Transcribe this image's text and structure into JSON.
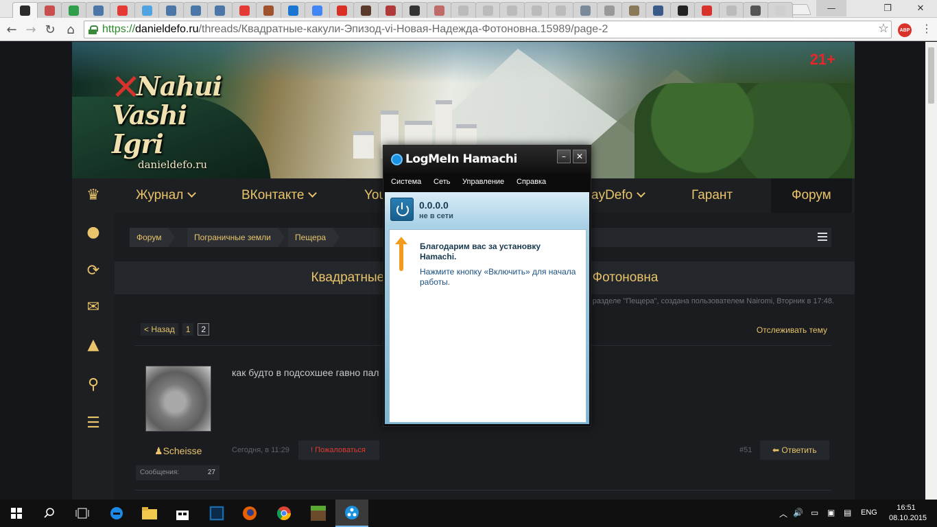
{
  "browser": {
    "url_scheme": "https://",
    "url_host": "danieldefo.ru",
    "url_path": "/threads/Квадратные-какули-Эпизод-vi-Новая-Надежда-Фотоновна.15989/page-2",
    "extension_badge": "ABP",
    "tab_favicons": [
      "#2b2b2b",
      "#c94f4f",
      "#2f9e4a",
      "#4a76a8",
      "#e53935",
      "#4fa3e0",
      "#4a76a8",
      "#4a76a8",
      "#4a76a8",
      "#e53935",
      "#a0522d",
      "#1976d2",
      "#4285f4",
      "#d93025",
      "#5a3a2a",
      "#b03a3a",
      "#333333",
      "#c06a6a",
      "#bbbbbb",
      "#bbbbbb",
      "#bbbbbb",
      "#bbbbbb",
      "#bbbbbb",
      "#7a8a9a",
      "#999999",
      "#8a7a5a",
      "#3a5a8a",
      "#222222",
      "#d9322b",
      "#bbbbbb",
      "#555555",
      "#cfcfcf"
    ]
  },
  "site": {
    "logo_line1": "Nahui",
    "logo_line2": "Vashi Igri",
    "logo_domain": "danieldefo.ru",
    "age_badge": "21+",
    "nav": [
      {
        "label": "Журнал"
      },
      {
        "label": "ВКонтакте"
      },
      {
        "label": "You"
      },
      {
        "label": "ayDefo"
      },
      {
        "label": "Гарант"
      },
      {
        "label": "Форум"
      }
    ],
    "sidebar_icons": [
      "crown-icon",
      "user-icon",
      "refresh-icon",
      "mail-icon",
      "bell-icon",
      "search-icon",
      "list-icon"
    ],
    "breadcrumb": [
      "Форум",
      "Пограничные земли",
      "Пещера"
    ],
    "thread_title": "Квадратные какули Эпизод vi Новая Надежда Фотоновна",
    "thread_meta": "Тема в разделе \"Пещера\", создана пользователем Nairomi, Вторник в 17:48.",
    "pagination": {
      "prev": "< Назад",
      "pages": [
        "1",
        "2"
      ],
      "current": "2"
    },
    "watch_label": "Отслеживать тему",
    "post": {
      "text": "как будто в подсохшее гавно пал",
      "username": "Scheisse",
      "messages_label": "Сообщения:",
      "messages_count": "27",
      "date": "Сегодня, в 11:29",
      "report_label": "Пожаловаться",
      "number": "#51",
      "reply_label": "Ответить"
    }
  },
  "hamachi": {
    "title": "LogMeIn Hamachi",
    "menu": [
      "Система",
      "Сеть",
      "Управление",
      "Справка"
    ],
    "ip": "0.0.0.0",
    "state": "не в сети",
    "heading": "Благодарим вас за установку Hamachi.",
    "hint": "Нажмите кнопку «Включить» для начала работы.",
    "accent": "#1b92e0"
  },
  "taskbar": {
    "language": "ENG",
    "time": "16:51",
    "date": "08.10.2015"
  }
}
